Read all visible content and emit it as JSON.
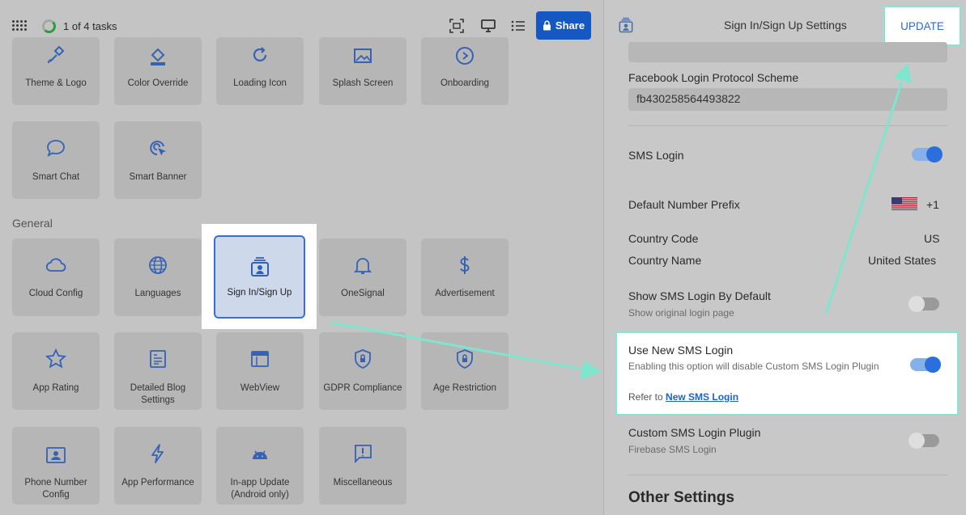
{
  "topbar": {
    "tasks": "1 of 4 tasks",
    "share_label": "Share"
  },
  "tiles_top": [
    "Theme & Logo",
    "Color Override",
    "Loading Icon",
    "Splash Screen",
    "Onboarding"
  ],
  "tiles_row2": [
    "Smart Chat",
    "Smart Banner"
  ],
  "section_general": "General",
  "tiles_general_1": [
    "Cloud Config",
    "Languages",
    "Sign In/Sign Up",
    "OneSignal",
    "Advertisement"
  ],
  "tiles_general_2": [
    "App Rating",
    "Detailed Blog Settings",
    "WebView",
    "GDPR Compliance",
    "Age Restriction"
  ],
  "tiles_general_3": [
    "Phone Number Config",
    "App Performance",
    "In-app Update (Android only)",
    "Miscellaneous"
  ],
  "panel": {
    "title": "Sign In/Sign Up Settings",
    "update_label": "UPDATE",
    "fb_label": "Facebook Login Protocol Scheme",
    "fb_value": "fb430258564493822",
    "sms_login": "SMS Login",
    "prefix_label": "Default Number Prefix",
    "prefix_value": "+1",
    "country_code_label": "Country Code",
    "country_code_value": "US",
    "country_name_label": "Country Name",
    "country_name_value": "United States",
    "show_sms_label": "Show SMS Login By Default",
    "show_sms_sub": "Show original login page",
    "new_sms_label": "Use New SMS Login",
    "new_sms_sub": "Enabling this option will disable Custom SMS Login Plugin",
    "refer_to": "Refer to",
    "new_sms_link": "New SMS Login",
    "custom_label": "Custom SMS Login Plugin",
    "custom_sub": "Firebase SMS Login",
    "other_settings": "Other Settings"
  },
  "colors": {
    "accent": "#2b6fdc",
    "highlight": "#86e4cf",
    "share": "#1658c2"
  }
}
